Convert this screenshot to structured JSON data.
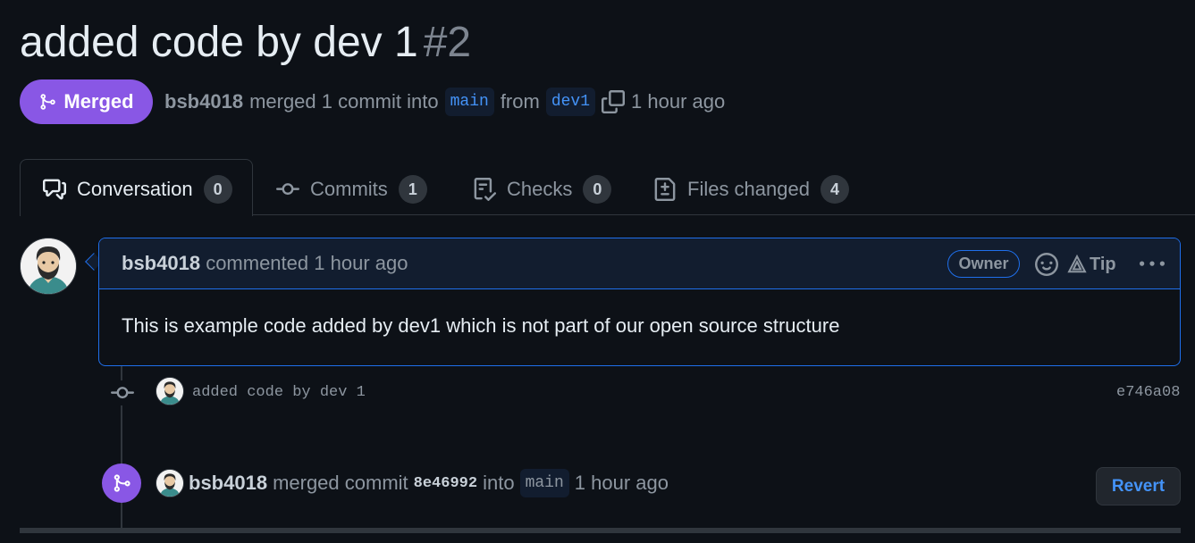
{
  "pr": {
    "title": "added code by dev 1",
    "number": "#2",
    "state_label": "Merged",
    "author": "bsb4018",
    "merge_text": "merged 1 commit into",
    "base_branch": "main",
    "from_text": "from",
    "head_branch": "dev1",
    "time": "1 hour ago"
  },
  "tabs": [
    {
      "label": "Conversation",
      "count": "0",
      "icon": "comment-discussion-icon"
    },
    {
      "label": "Commits",
      "count": "1",
      "icon": "git-commit-icon"
    },
    {
      "label": "Checks",
      "count": "0",
      "icon": "checklist-icon"
    },
    {
      "label": "Files changed",
      "count": "4",
      "icon": "file-diff-icon"
    }
  ],
  "comment": {
    "author": "bsb4018",
    "action": "commented",
    "time": "1 hour ago",
    "role_badge": "Owner",
    "tip_label": "Tip",
    "body": "This is example code added by dev1 which is not part of our open source structure"
  },
  "commit": {
    "message": "added code by dev 1",
    "sha": "e746a08"
  },
  "merge_event": {
    "author": "bsb4018",
    "text": "merged commit",
    "sha": "8e46992",
    "into_text": "into",
    "branch": "main",
    "time": "1 hour ago",
    "revert_label": "Revert"
  },
  "colors": {
    "background": "#0d1117",
    "merged_purple": "#8957e5",
    "link_blue": "#4493f8",
    "comment_border": "#1f6feb"
  }
}
